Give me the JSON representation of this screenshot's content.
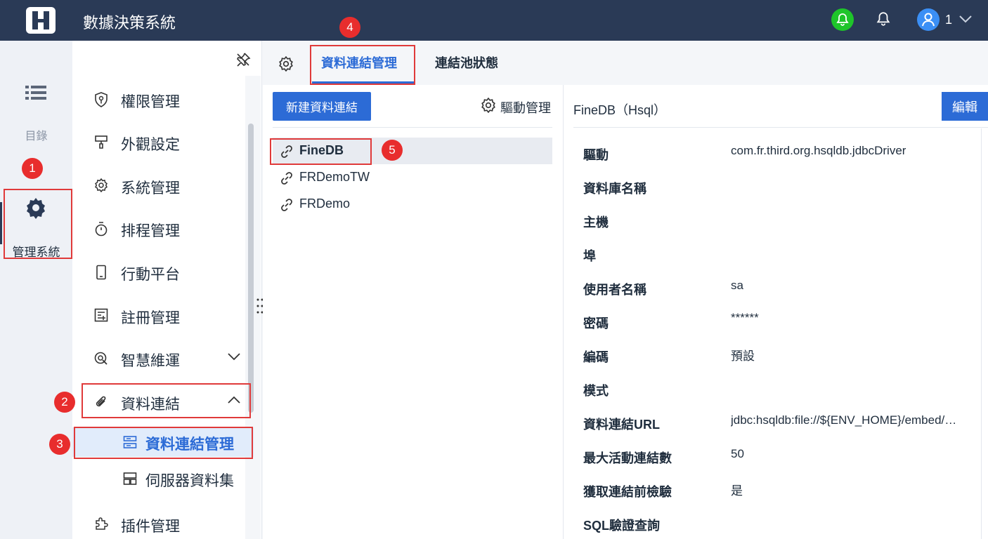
{
  "header": {
    "app_title": "數據決策系統",
    "user_name": "1",
    "icons": [
      "logo-icon",
      "notification-bell-active-icon",
      "notification-bell-icon",
      "user-avatar-icon",
      "chevron-down-icon"
    ],
    "colors": {
      "bar": "#2a3a56",
      "bell_active": "#1ec52a",
      "avatar": "#3b8ff5"
    }
  },
  "rail": {
    "catalog_label": "目錄",
    "admin_label": "管理系統"
  },
  "menu": {
    "items": [
      {
        "label": "權限管理",
        "icon": "permission-icon"
      },
      {
        "label": "外觀設定",
        "icon": "appearance-icon"
      },
      {
        "label": "系統管理",
        "icon": "system-gear-icon"
      },
      {
        "label": "排程管理",
        "icon": "timer-icon"
      },
      {
        "label": "行動平台",
        "icon": "mobile-icon"
      },
      {
        "label": "註冊管理",
        "icon": "register-icon"
      },
      {
        "label": "智慧維運",
        "icon": "ops-icon"
      },
      {
        "label": "資料連結",
        "icon": "paperclip-icon"
      },
      {
        "label": "插件管理",
        "icon": "plugin-icon"
      }
    ],
    "sub_items": [
      {
        "label": "資料連結管理",
        "icon": "connection-manage-icon",
        "active": true
      },
      {
        "label": "伺服器資料集",
        "icon": "server-dataset-icon",
        "active": false
      }
    ]
  },
  "tabs": {
    "items": [
      {
        "label": "資料連結管理",
        "active": true
      },
      {
        "label": "連結池狀態",
        "active": false
      }
    ]
  },
  "list": {
    "new_button": "新建資料連結",
    "driver_mgmt": "驅動管理",
    "connections": [
      {
        "name": "FineDB",
        "selected": true
      },
      {
        "name": "FRDemoTW",
        "selected": false
      },
      {
        "name": "FRDemo",
        "selected": false
      }
    ]
  },
  "detail": {
    "title": "FineDB（Hsql）",
    "edit_button": "編輯",
    "properties": [
      {
        "label": "驅動",
        "value": "com.fr.third.org.hsqldb.jdbcDriver"
      },
      {
        "label": "資料庫名稱",
        "value": ""
      },
      {
        "label": "主機",
        "value": ""
      },
      {
        "label": "埠",
        "value": ""
      },
      {
        "label": "使用者名稱",
        "value": "sa"
      },
      {
        "label": "密碼",
        "value": "******"
      },
      {
        "label": "編碼",
        "value": "預設"
      },
      {
        "label": "模式",
        "value": ""
      },
      {
        "label": "資料連結URL",
        "value": "jdbc:hsqldb:file://${ENV_HOME}/embed/…"
      },
      {
        "label": "最大活動連結數",
        "value": "50"
      },
      {
        "label": "獲取連結前檢驗",
        "value": "是"
      },
      {
        "label": "SQL驗證查詢",
        "value": ""
      }
    ]
  },
  "annotations": {
    "badges": [
      "1",
      "2",
      "3",
      "4",
      "5"
    ],
    "color": "#e03a3a"
  }
}
